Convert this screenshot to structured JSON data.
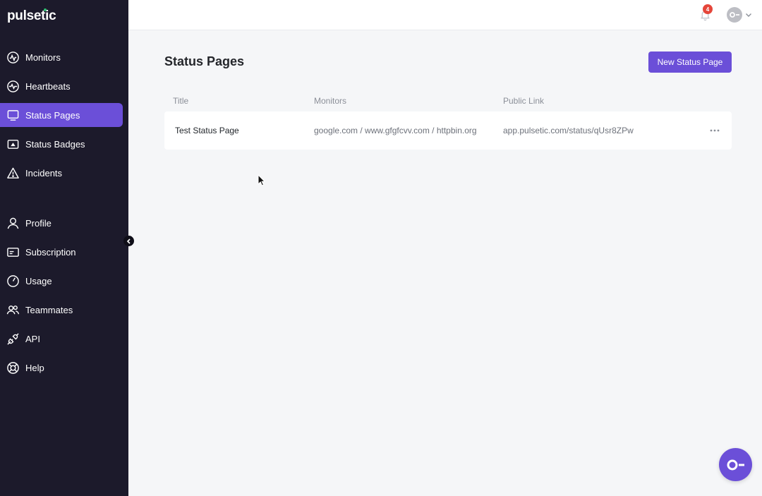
{
  "app": {
    "logo": "pulsetic"
  },
  "sidebar": {
    "primary": [
      {
        "label": "Monitors",
        "icon": "monitor-pulse-icon",
        "active": false
      },
      {
        "label": "Heartbeats",
        "icon": "heartbeat-icon",
        "active": false
      },
      {
        "label": "Status Pages",
        "icon": "screen-icon",
        "active": true
      },
      {
        "label": "Status Badges",
        "icon": "badge-icon",
        "active": false
      },
      {
        "label": "Incidents",
        "icon": "warning-icon",
        "active": false
      }
    ],
    "secondary": [
      {
        "label": "Profile",
        "icon": "user-icon"
      },
      {
        "label": "Subscription",
        "icon": "card-icon"
      },
      {
        "label": "Usage",
        "icon": "gauge-icon"
      },
      {
        "label": "Teammates",
        "icon": "team-icon"
      },
      {
        "label": "API",
        "icon": "plug-icon"
      },
      {
        "label": "Help",
        "icon": "lifebuoy-icon"
      }
    ]
  },
  "topbar": {
    "notifications_count": "4"
  },
  "main": {
    "title": "Status Pages",
    "new_button_label": "New Status Page",
    "table": {
      "headers": {
        "title": "Title",
        "monitors": "Monitors",
        "public_link": "Public Link"
      },
      "rows": [
        {
          "title": "Test Status Page",
          "monitors": "google.com / www.gfgfcvv.com / httpbin.org",
          "public_link": "app.pulsetic.com/status/qUsr8ZPw"
        }
      ]
    }
  },
  "colors": {
    "sidebar_bg": "#1c1a2b",
    "accent": "#6b4fd8",
    "badge": "#e5463a",
    "page_bg": "#f5f6f8"
  }
}
